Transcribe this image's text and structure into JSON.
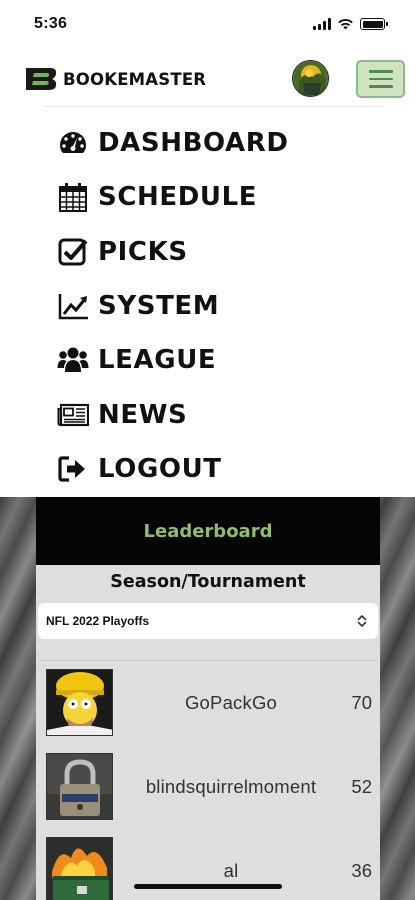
{
  "status_bar": {
    "time": "5:36"
  },
  "header": {
    "brand": "BOOKEMASTER",
    "brand_color": "#111111",
    "menu_button_color": "#cfe3c3"
  },
  "nav": {
    "items": [
      {
        "label": "DASHBOARD",
        "icon": "tachometer-icon"
      },
      {
        "label": "SCHEDULE",
        "icon": "calendar-icon"
      },
      {
        "label": "PICKS",
        "icon": "checkbox-icon"
      },
      {
        "label": "SYSTEM",
        "icon": "line-chart-icon"
      },
      {
        "label": "LEAGUE",
        "icon": "users-icon"
      },
      {
        "label": "NEWS",
        "icon": "newspaper-icon"
      },
      {
        "label": "LOGOUT",
        "icon": "sign-out-icon"
      }
    ]
  },
  "leaderboard": {
    "title": "Leaderboard",
    "title_color": "#8fbf6e",
    "section_label": "Season/Tournament",
    "select_value": "NFL 2022 Playoffs",
    "rows": [
      {
        "name": "GoPackGo",
        "points": "70"
      },
      {
        "name": "blindsquirrelmoment",
        "points": "52"
      },
      {
        "name": "al",
        "points": "36"
      }
    ]
  }
}
